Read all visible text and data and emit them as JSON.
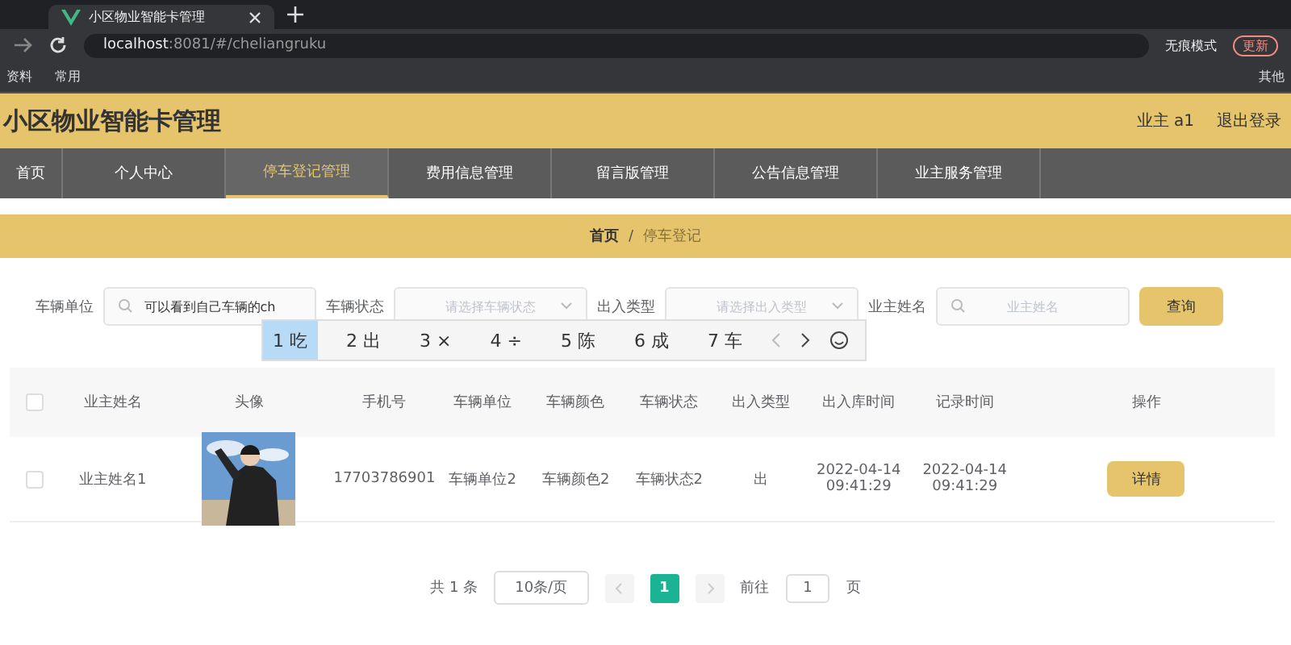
{
  "browser": {
    "tab_title": "小区物业智能卡管理",
    "url_host": "localhost",
    "url_rest": ":8081/#/cheliangruku",
    "profile": "无痕模式",
    "update": "更新",
    "bookmarks": [
      "资料",
      "常用"
    ],
    "other_bookmarks": "其他"
  },
  "header": {
    "title": "小区物业智能卡管理",
    "user": "业主 a1",
    "logout": "退出登录"
  },
  "nav": [
    {
      "label": "首页",
      "selected": false
    },
    {
      "label": "个人中心",
      "selected": false
    },
    {
      "label": "停车登记管理",
      "selected": true
    },
    {
      "label": "费用信息管理",
      "selected": false
    },
    {
      "label": "留言版管理",
      "selected": false
    },
    {
      "label": "公告信息管理",
      "selected": false
    },
    {
      "label": "业主服务管理",
      "selected": false
    }
  ],
  "breadcrumb": [
    "首页",
    "/",
    "停车登记"
  ],
  "search": {
    "fields": [
      {
        "label": "车辆单位",
        "kind": "text",
        "value": "可以看到自己车辆的ch"
      },
      {
        "label": "车辆状态",
        "kind": "select",
        "placeholder": "请选择车辆状态"
      },
      {
        "label": "出入类型",
        "kind": "select",
        "placeholder": "请选择出入类型"
      },
      {
        "label": "业主姓名",
        "kind": "text",
        "placeholder": "业主姓名"
      }
    ],
    "button": "查询"
  },
  "ime": {
    "candidates": [
      {
        "label": "1 吃",
        "selected": true
      },
      {
        "label": "2 出",
        "selected": false
      },
      {
        "label": "3 ×",
        "selected": false
      },
      {
        "label": "4 ÷",
        "selected": false
      },
      {
        "label": "5 陈",
        "selected": false
      },
      {
        "label": "6 成",
        "selected": false
      },
      {
        "label": "7 车",
        "selected": false
      }
    ]
  },
  "table": {
    "select_all": false,
    "columns": [
      "业主姓名",
      "头像",
      "手机号",
      "车辆单位",
      "车辆颜色",
      "车辆状态",
      "出入类型",
      "出入库时间",
      "记录时间",
      "操作"
    ],
    "rows": [
      {
        "checked": false,
        "cells": [
          "业主姓名1",
          {
            "kind": "picture"
          },
          "17703786901",
          "车辆单位2",
          "车辆颜色2",
          "车辆状态2",
          "出",
          "2022-04-14 09:41:29",
          "2022-04-14 09:41:29"
        ],
        "action": "详情"
      }
    ]
  },
  "pagination": {
    "total": "共 1 条",
    "page_size": "10条/页",
    "pages": [
      {
        "label": "1",
        "selected": true
      }
    ],
    "goto": "前往",
    "goto_value": "1",
    "page_unit": "页"
  }
}
